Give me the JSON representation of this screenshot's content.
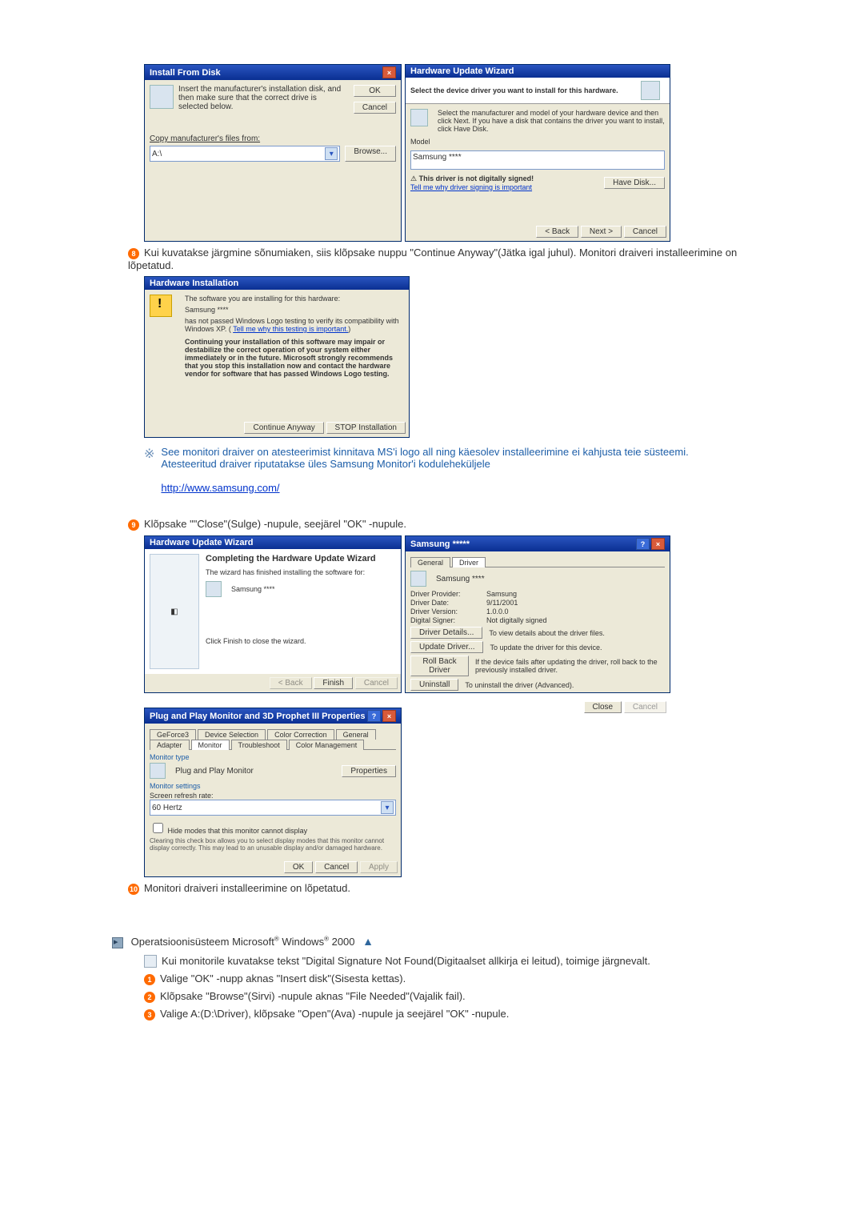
{
  "steps": {
    "s8": "Kui kuvatakse järgmine sõnumiaken, siis klõpsake nuppu \"Continue Anyway\"(Jätka igal juhul). Monitori draiveri installeerimine on lõpetatud.",
    "s9": "Klõpsake \"\"Close\"(Sulge) -nupule, seejärel \"OK\" -nupule.",
    "s10": "Monitori draiveri installeerimine on lõpetatud."
  },
  "note": {
    "line1": "See monitori draiver on atesteerimist kinnitava MS'i logo all ning käesolev installeerimine ei kahjusta teie süsteemi.",
    "line2": "Atesteeritud draiver riputatakse üles Samsung Monitor'i koduleheküljele",
    "url": "http://www.samsung.com/"
  },
  "os_heading_prefix": "Operatsioonisüsteem Microsoft",
  "os_heading_mid": " Windows",
  "os_heading_suffix": " 2000",
  "win2000": {
    "intro": "Kui monitorile kuvatakse tekst \"Digital Signature Not Found(Digitaalset allkirja ei leitud), toimige järgnevalt.",
    "s1": "Valige \"OK\" -nupp aknas \"Insert disk\"(Sisesta kettas).",
    "s2": "Klõpsake \"Browse\"(Sirvi) -nupule aknas \"File Needed\"(Vajalik fail).",
    "s3": "Valige A:(D:\\Driver), klõpsake \"Open\"(Ava) -nupule ja seejärel \"OK\" -nupule."
  },
  "install_from_disk": {
    "title": "Install From Disk",
    "msg": "Insert the manufacturer's installation disk, and then make sure that the correct drive is selected below.",
    "ok": "OK",
    "cancel": "Cancel",
    "copy_label": "Copy manufacturer's files from:",
    "path": "A:\\",
    "browse": "Browse..."
  },
  "hw_wiz1": {
    "title": "Hardware Update Wizard",
    "select_text": "Select the device driver you want to install for this hardware.",
    "body": "Select the manufacturer and model of your hardware device and then click Next. If you have a disk that contains the driver you want to install, click Have Disk.",
    "model_label": "Model",
    "model_value": "Samsung ****",
    "not_signed": "This driver is not digitally signed!",
    "tell_why": "Tell me why driver signing is important",
    "have_disk": "Have Disk...",
    "back": "< Back",
    "next": "Next >",
    "cancel": "Cancel"
  },
  "hw_install": {
    "title": "Hardware Installation",
    "line1": "The software you are installing for this hardware:",
    "device": "Samsung ****",
    "line2": "has not passed Windows Logo testing to verify its compatibility with Windows XP. (",
    "link": "Tell me why this testing is important.",
    "bold": "Continuing your installation of this software may impair or destabilize the correct operation of your system either immediately or in the future. Microsoft strongly recommends that you stop this installation now and contact the hardware vendor for software that has passed Windows Logo testing.",
    "continue": "Continue Anyway",
    "stop": "STOP Installation"
  },
  "hw_wiz2": {
    "title": "Hardware Update Wizard",
    "h": "Completing the Hardware Update Wizard",
    "sub": "The wizard has finished installing the software for:",
    "device": "Samsung ****",
    "click_finish": "Click Finish to close the wizard.",
    "back": "< Back",
    "finish": "Finish",
    "cancel": "Cancel"
  },
  "driver_props": {
    "title": "Samsung *****",
    "tab_general": "General",
    "tab_driver": "Driver",
    "device": "Samsung ****",
    "provider_k": "Driver Provider:",
    "provider_v": "Samsung",
    "date_k": "Driver Date:",
    "date_v": "9/11/2001",
    "version_k": "Driver Version:",
    "version_v": "1.0.0.0",
    "signer_k": "Digital Signer:",
    "signer_v": "Not digitally signed",
    "details_btn": "Driver Details...",
    "details_desc": "To view details about the driver files.",
    "update_btn": "Update Driver...",
    "update_desc": "To update the driver for this device.",
    "rollback_btn": "Roll Back Driver",
    "rollback_desc": "If the device fails after updating the driver, roll back to the previously installed driver.",
    "uninstall_btn": "Uninstall",
    "uninstall_desc": "To uninstall the driver (Advanced).",
    "close": "Close",
    "cancel": "Cancel"
  },
  "monitor_props": {
    "title": "Plug and Play Monitor and 3D Prophet III Properties",
    "tabs": [
      "GeForce3",
      "Device Selection",
      "Color Correction",
      "General",
      "Adapter",
      "Monitor",
      "Troubleshoot",
      "Color Management"
    ],
    "type_label": "Monitor type",
    "type_value": "Plug and Play Monitor",
    "properties": "Properties",
    "settings_label": "Monitor settings",
    "refresh_label": "Screen refresh rate:",
    "refresh_value": "60 Hertz",
    "hide_modes": "Hide modes that this monitor cannot display",
    "hide_desc": "Clearing this check box allows you to select display modes that this monitor cannot display correctly. This may lead to an unusable display and/or damaged hardware.",
    "ok": "OK",
    "cancel": "Cancel",
    "apply": "Apply"
  }
}
